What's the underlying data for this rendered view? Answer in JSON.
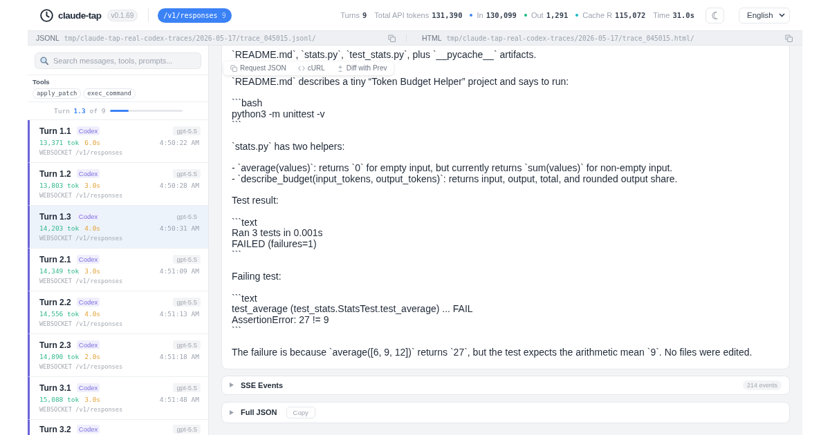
{
  "header": {
    "app_name": "claude-tap",
    "version": "v0.1.69",
    "endpoint": {
      "label": "/v1/responses",
      "count": "9"
    },
    "stats": [
      {
        "label": "Turns",
        "value": "9"
      },
      {
        "label": "Total API tokens",
        "value": "131,390"
      },
      {
        "label": "In",
        "value": "130,099",
        "color": "#3b82f6"
      },
      {
        "label": "Out",
        "value": "1,291",
        "color": "#10b981"
      },
      {
        "label": "Cache R",
        "value": "115,072",
        "color": "#14b8c4"
      },
      {
        "label": "Time",
        "value": "31.0s"
      }
    ],
    "language": "English"
  },
  "paths": [
    {
      "label": "JSONL",
      "path": "tmp/claude-tap-real-codex-traces/2026-05-17/trace_045015.jsonl/"
    },
    {
      "label": "HTML",
      "path": "tmp/claude-tap-real-codex-traces/2026-05-17/trace_045015.html/"
    }
  ],
  "sidebar": {
    "search": {
      "placeholder": "Search messages, tools, prompts..."
    },
    "tools_label": "Tools",
    "tools": [
      "apply_patch",
      "exec_command"
    ],
    "turn_nav": {
      "text": "Turn **1.3** of 9",
      "level": 0.25
    },
    "turns": [
      {
        "title": "Turn 1.1",
        "agent": "Codex",
        "model": "gpt-5.5",
        "tokens": "13,371 tok",
        "duration": "6.0s",
        "time": "4:50:22 AM",
        "endpoint": "WEBSOCKET /v1/responses",
        "selected": false
      },
      {
        "title": "Turn 1.2",
        "agent": "Codex",
        "model": "gpt-5.5",
        "tokens": "13,803 tok",
        "duration": "3.0s",
        "time": "4:50:28 AM",
        "endpoint": "WEBSOCKET /v1/responses",
        "selected": false
      },
      {
        "title": "Turn 1.3",
        "agent": "Codex",
        "model": "gpt-5.5",
        "tokens": "14,203 tok",
        "duration": "4.0s",
        "time": "4:50:31 AM",
        "endpoint": "WEBSOCKET /v1/responses",
        "selected": true
      },
      {
        "title": "Turn 2.1",
        "agent": "Codex",
        "model": "gpt-5.5",
        "tokens": "14,349 tok",
        "duration": "3.0s",
        "time": "4:51:09 AM",
        "endpoint": "WEBSOCKET /v1/responses",
        "selected": false
      },
      {
        "title": "Turn 2.2",
        "agent": "Codex",
        "model": "gpt-5.5",
        "tokens": "14,556 tok",
        "duration": "4.0s",
        "time": "4:51:13 AM",
        "endpoint": "WEBSOCKET /v1/responses",
        "selected": false
      },
      {
        "title": "Turn 2.3",
        "agent": "Codex",
        "model": "gpt-5.5",
        "tokens": "14,890 tok",
        "duration": "2.0s",
        "time": "4:51:18 AM",
        "endpoint": "WEBSOCKET /v1/responses",
        "selected": false
      },
      {
        "title": "Turn 3.1",
        "agent": "Codex",
        "model": "gpt-5.5",
        "tokens": "15,088 tok",
        "duration": "3.0s",
        "time": "4:51:48 AM",
        "endpoint": "WEBSOCKET /v1/responses",
        "selected": false
      },
      {
        "title": "Turn 3.2",
        "agent": "Codex",
        "model": "gpt-5.5",
        "selected": false
      }
    ]
  },
  "detail": {
    "toolbar": [
      {
        "kind": "copy",
        "label": "Request JSON"
      },
      {
        "kind": "code",
        "label": "cURL"
      },
      {
        "kind": "diff",
        "label": "Diff with Prev"
      }
    ],
    "response_blocks": [
      "`README.md`, `stats.py`, `test_stats.py`, plus `__pycache__` artifacts.",
      "`README.md` describes a tiny “Token Budget Helper” project and says to run:",
      "```bash\npython3 -m unittest -v\n```",
      "`stats.py` has two helpers:",
      "- `average(values)`: returns `0` for empty input, but currently returns `sum(values)` for non-empty input.\n- `describe_budget(input_tokens, output_tokens)`: returns input, output, total, and rounded output share.",
      "Test result:",
      "```text\nRan 3 tests in 0.001s\nFAILED (failures=1)\n```",
      "Failing test:",
      "```text\ntest_average (test_stats.StatsTest.test_average) ... FAIL\nAssertionError: 27 != 9\n```",
      "The failure is because `average([6, 9, 12])` returns `27`, but the test expects the arithmetic mean `9`. No files were edited."
    ],
    "sections": [
      {
        "title": "SSE Events",
        "expanded": false,
        "count": "214 events"
      },
      {
        "title": "Full JSON",
        "expanded": false,
        "action": "Copy"
      }
    ]
  }
}
